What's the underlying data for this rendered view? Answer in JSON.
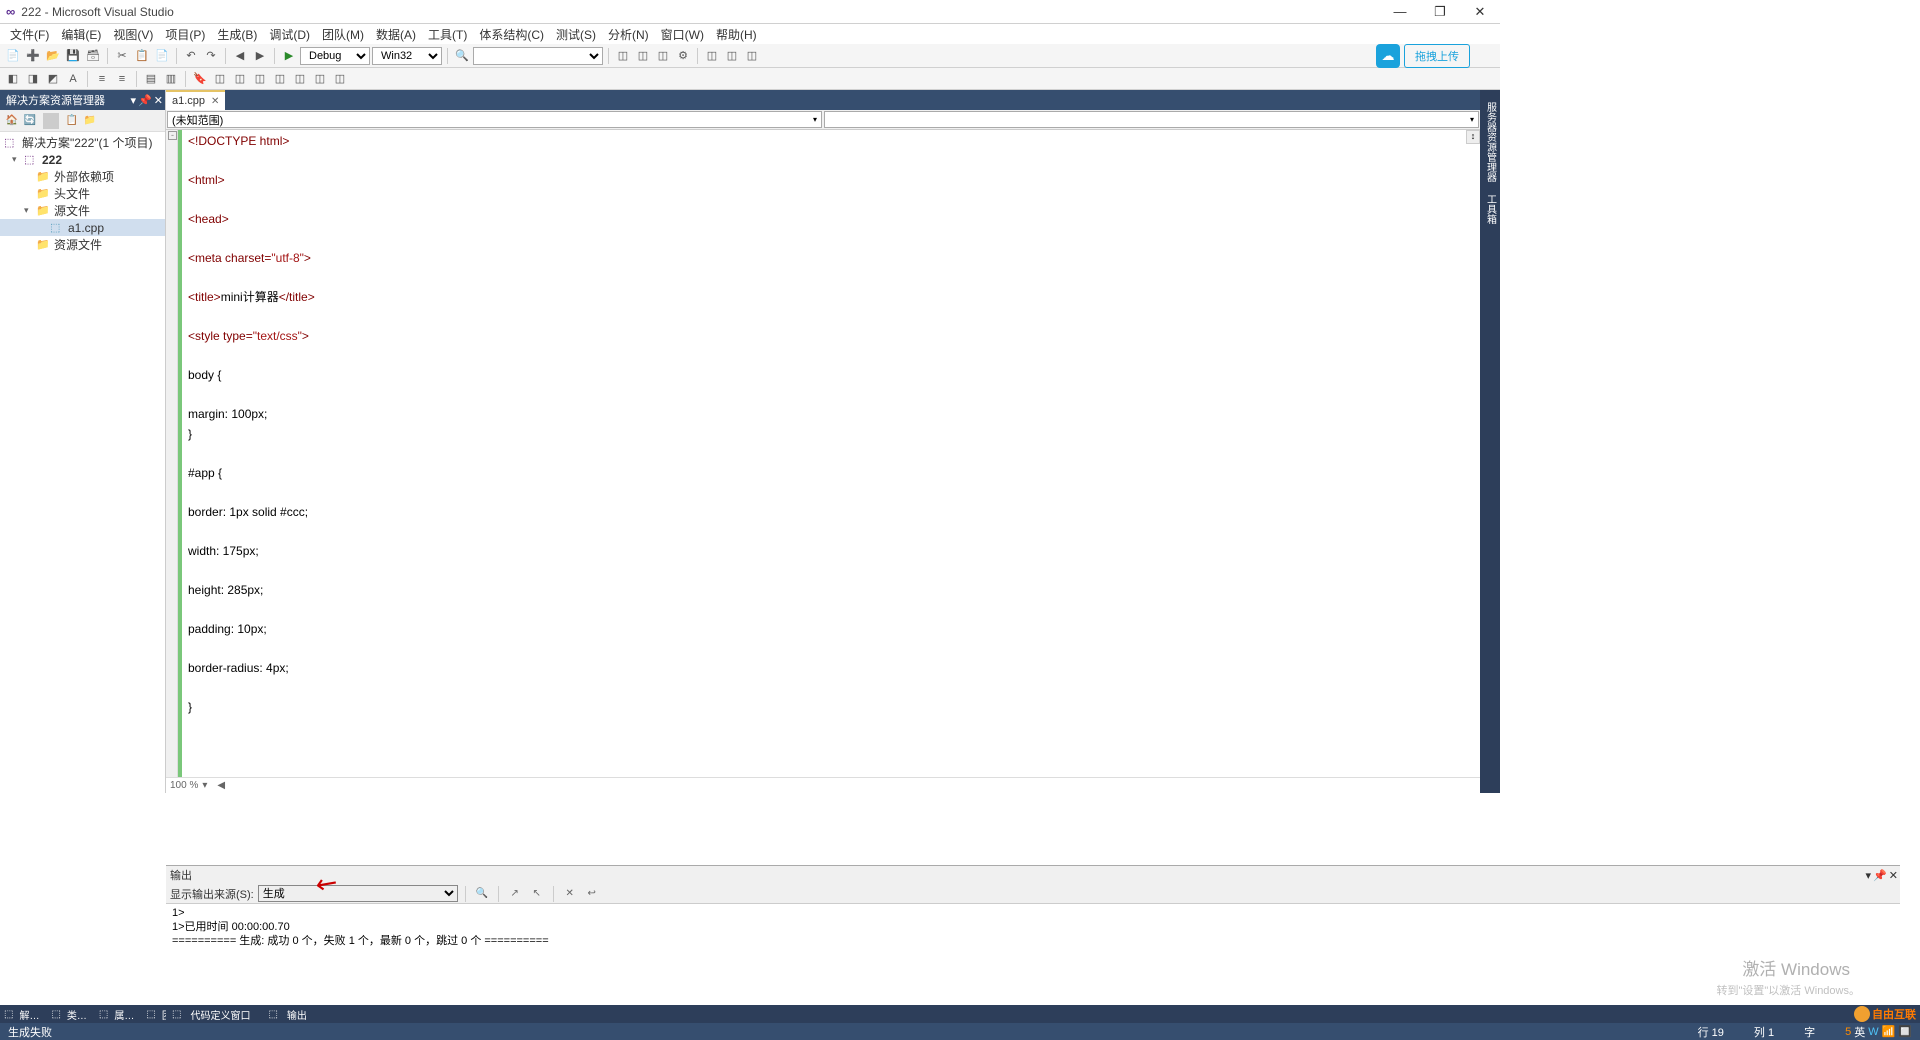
{
  "title": "222 - Microsoft Visual Studio",
  "menu": [
    "文件(F)",
    "编辑(E)",
    "视图(V)",
    "项目(P)",
    "生成(B)",
    "调试(D)",
    "团队(M)",
    "数据(A)",
    "工具(T)",
    "体系结构(C)",
    "测试(S)",
    "分析(N)",
    "窗口(W)",
    "帮助(H)"
  ],
  "toolbar": {
    "config": "Debug",
    "platform": "Win32",
    "upload_label": "拖拽上传"
  },
  "solution": {
    "title": "解决方案资源管理器",
    "root": "解决方案\"222\"(1 个项目)",
    "project": "222",
    "deps": "外部依赖项",
    "headers": "头文件",
    "sources": "源文件",
    "file": "a1.cpp",
    "resources": "资源文件"
  },
  "tab": {
    "filename": "a1.cpp"
  },
  "nav": {
    "scope": "(未知范围)"
  },
  "code": {
    "l1": "<!DOCTYPE html>",
    "l2": "<html>",
    "l3": "<head>",
    "l4a": "<meta charset=",
    "l4b": "\"utf-8\"",
    "l4c": ">",
    "l5a": "<title>",
    "l5b": "mini计算器",
    "l5c": "</title>",
    "l6a": "<style type=",
    "l6b": "\"text/css\"",
    "l6c": ">",
    "l7": "body {",
    "l8": "margin: 100px;",
    "l9": "}",
    "l10": "#app {",
    "l11": "border: 1px solid #ccc;",
    "l12": "width: 175px;",
    "l13": "height: 285px;",
    "l14": "padding: 10px;",
    "l15": "border-radius: 4px;",
    "l16": "}"
  },
  "zoom": "100 %",
  "output": {
    "title": "输出",
    "source_label": "显示输出来源(S):",
    "source_value": "生成",
    "line1": "1>",
    "line2": "1>已用时间 00:00:00.70",
    "line3": "========== 生成: 成功 0 个，失败 1 个，最新 0 个，跳过 0 个 =========="
  },
  "bottom": {
    "t1": "解…",
    "t2": "类…",
    "t3": "属…",
    "t4": "团…",
    "def": "代码定义窗口",
    "out": "输出"
  },
  "status": {
    "left": "生成失败",
    "line": "行 19",
    "col": "列 1",
    "char": "字"
  },
  "watermark": {
    "l1": "激活 Windows",
    "l2": "转到\"设置\"以激活 Windows。",
    "logo": "自由互联"
  }
}
